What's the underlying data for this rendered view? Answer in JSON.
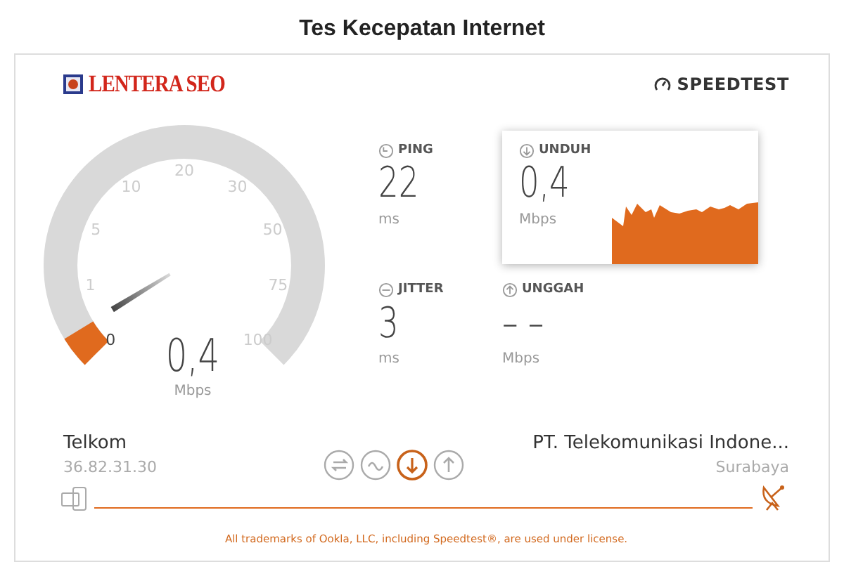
{
  "title": "Tes Kecepatan Internet",
  "logo": "LENTERA SEO",
  "brand": "SPEEDTEST",
  "gauge": {
    "ticks": [
      "0",
      "1",
      "5",
      "10",
      "20",
      "30",
      "50",
      "75",
      "100"
    ],
    "level": 0.05,
    "reading": "0,4",
    "unit": "Mbps"
  },
  "metrics": [
    {
      "kind": "ping",
      "label": "PING",
      "value": "22",
      "unit": "ms",
      "selected": false
    },
    {
      "kind": "download",
      "label": "UNDUH",
      "value": "0,4",
      "unit": "Mbps",
      "selected": true
    },
    {
      "kind": "jitter",
      "label": "JITTER",
      "value": "3",
      "unit": "ms",
      "selected": false
    },
    {
      "kind": "upload",
      "label": "UNGGAH",
      "value": "– –",
      "unit": "Mbps",
      "selected": false
    }
  ],
  "isp": {
    "name": "Telkom",
    "ip": "36.82.31.30"
  },
  "stages": [
    {
      "kind": "ping",
      "selected": false
    },
    {
      "kind": "jitter",
      "selected": false
    },
    {
      "kind": "download",
      "selected": true
    },
    {
      "kind": "upload",
      "selected": false
    }
  ],
  "server": {
    "name": "PT. Telekomunikasi Indone...",
    "city": "Surabaya"
  },
  "footer": "All trademarks of Ookla, LLC, including Speedtest®, are used under license."
}
